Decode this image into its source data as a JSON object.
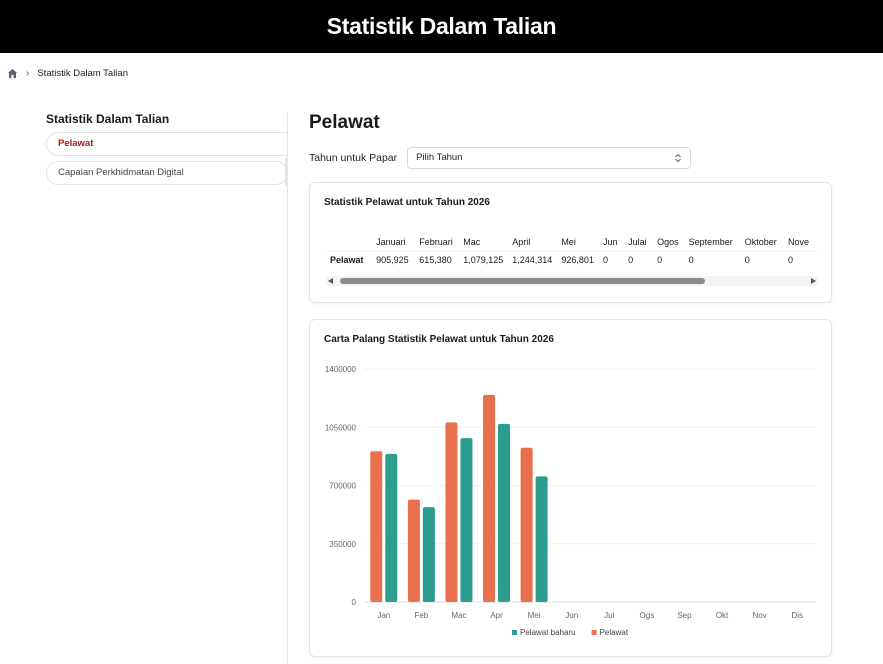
{
  "header": {
    "title": "Statistik Dalam Talian"
  },
  "breadcrumb": {
    "current": "Statistik Dalam Talian"
  },
  "sidebar": {
    "title": "Statistik Dalam Talian",
    "items": [
      {
        "label": "Pelawat",
        "active": true
      },
      {
        "label": "Capaian Perkhidmatan Digital",
        "active": false
      }
    ]
  },
  "main": {
    "title": "Pelawat",
    "year_label": "Tahun untuk Papar",
    "year_select": "Pilih Tahun"
  },
  "table_card": {
    "title": "Statistik Pelawat untuk Tahun 2026",
    "columns": [
      "Januari",
      "Februari",
      "Mac",
      "April",
      "Mei",
      "Jun",
      "Julai",
      "Ogos",
      "September",
      "Oktober",
      "Nove"
    ],
    "row_label": "Pelawat",
    "values": [
      "905,925",
      "615,380",
      "1,079,125",
      "1,244,314",
      "926,801",
      "0",
      "0",
      "0",
      "0",
      "0",
      "0"
    ]
  },
  "chart_card": {
    "title": "Carta Palang Statistik Pelawat untuk Tahun 2026"
  },
  "chart_data": {
    "type": "bar",
    "categories": [
      "Jan",
      "Feb",
      "Mac",
      "Apr",
      "Mei",
      "Jun",
      "Jul",
      "Ogs",
      "Sep",
      "Okt",
      "Nov",
      "Dis"
    ],
    "series": [
      {
        "name": "Pelawat",
        "color": "#e8704f",
        "values": [
          905925,
          615380,
          1079125,
          1244314,
          926801,
          0,
          0,
          0,
          0,
          0,
          0,
          0
        ]
      },
      {
        "name": "Pelawat baharu",
        "color": "#2a9d8f",
        "values": [
          890000,
          570000,
          985000,
          1070000,
          755000,
          0,
          0,
          0,
          0,
          0,
          0,
          0
        ]
      }
    ],
    "yticks": [
      0,
      350000,
      700000,
      1050000,
      1400000
    ],
    "ylim": [
      0,
      1400000
    ],
    "legend": [
      "Pelawat baharu",
      "Pelawat"
    ],
    "legend_position": "bottom",
    "grid": true
  }
}
